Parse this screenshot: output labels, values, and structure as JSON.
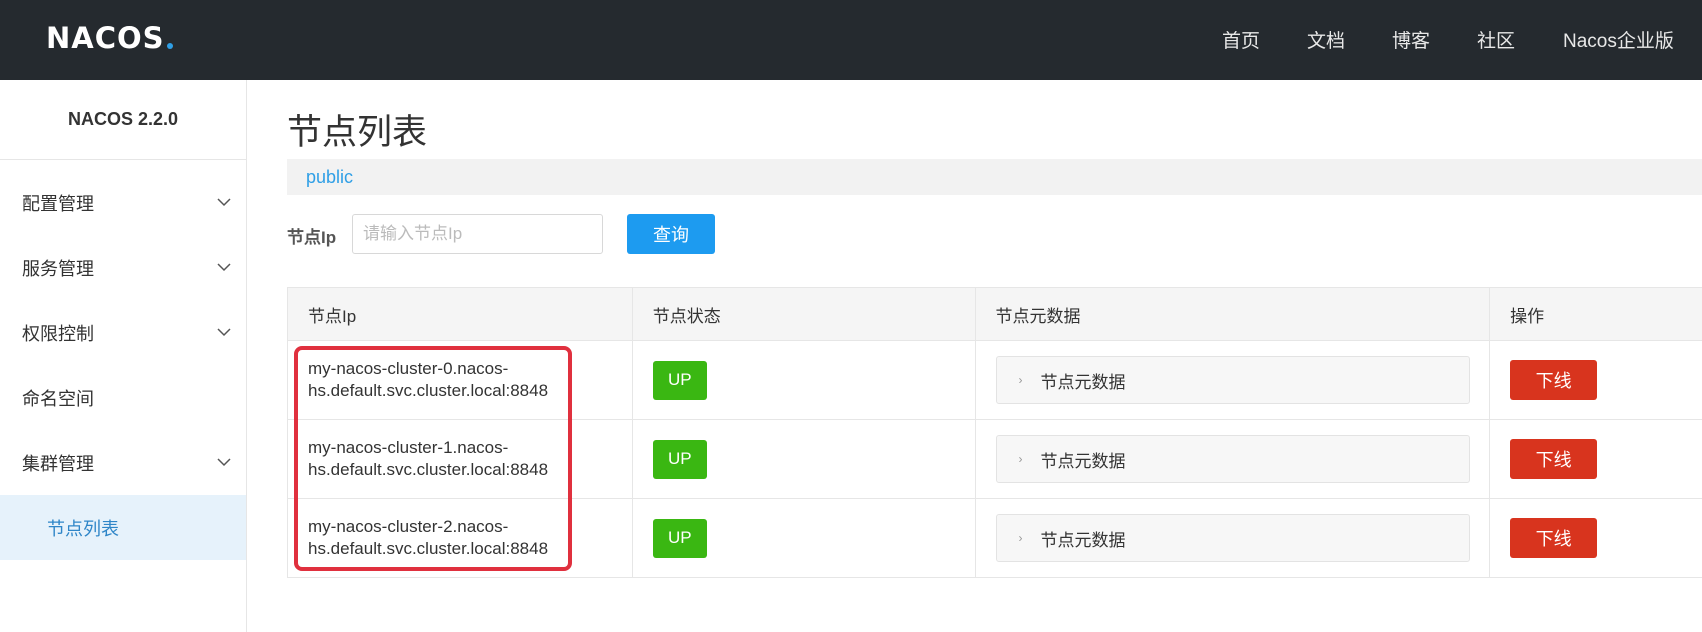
{
  "header": {
    "logo": "NACOS",
    "nav": [
      "首页",
      "文档",
      "博客",
      "社区",
      "Nacos企业版"
    ]
  },
  "sidebar": {
    "title": "NACOS 2.2.0",
    "items": [
      {
        "label": "配置管理",
        "expandable": true
      },
      {
        "label": "服务管理",
        "expandable": true
      },
      {
        "label": "权限控制",
        "expandable": true
      },
      {
        "label": "命名空间",
        "expandable": false
      },
      {
        "label": "集群管理",
        "expandable": true
      }
    ],
    "sub_item": "节点列表"
  },
  "main": {
    "title": "节点列表",
    "namespace": "public",
    "search": {
      "label": "节点Ip",
      "placeholder": "请输入节点Ip",
      "button": "查询"
    },
    "table": {
      "columns": [
        "节点Ip",
        "节点状态",
        "节点元数据",
        "操作"
      ],
      "rows": [
        {
          "ip_line1": "my-nacos-cluster-0.nacos-",
          "ip_line2": "hs.default.svc.cluster.local:8848",
          "status": "UP",
          "metadata": "节点元数据",
          "action": "下线"
        },
        {
          "ip_line1": "my-nacos-cluster-1.nacos-",
          "ip_line2": "hs.default.svc.cluster.local:8848",
          "status": "UP",
          "metadata": "节点元数据",
          "action": "下线"
        },
        {
          "ip_line1": "my-nacos-cluster-2.nacos-",
          "ip_line2": "hs.default.svc.cluster.local:8848",
          "status": "UP",
          "metadata": "节点元数据",
          "action": "下线"
        }
      ]
    }
  },
  "colors": {
    "header_bg": "#252a2f",
    "accent": "#1d9bf0",
    "status_up": "#3ab712",
    "danger": "#d8341e",
    "highlight": "#e0303e"
  }
}
